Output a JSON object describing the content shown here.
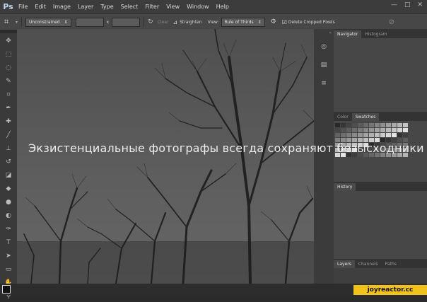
{
  "app": {
    "logo": "Ps"
  },
  "menubar": {
    "items": [
      "File",
      "Edit",
      "Image",
      "Layer",
      "Type",
      "Select",
      "Filter",
      "View",
      "Window",
      "Help"
    ]
  },
  "window_controls": {
    "minimize": "—",
    "maximize": "□",
    "close": "✕"
  },
  "options_bar": {
    "ratio_preset": "Unconstrained",
    "swap_symbol": "x",
    "clear_label": "Clear",
    "straighten_label": "Straighten",
    "view_label": "View:",
    "view_value": "Rule of Thirds",
    "delete_cropped_label": "Delete Cropped Pixels",
    "delete_cropped_checked": true
  },
  "panels": {
    "top_tabs": [
      "Navigator",
      "Histogram"
    ],
    "color_tabs": [
      "Color",
      "Swatches"
    ],
    "history_tab": "History",
    "bottom_tabs": [
      "Layers",
      "Channels",
      "Paths"
    ]
  },
  "canvas": {
    "caption": "Экзистенциальные фотографы всегда сохраняют безысходники"
  },
  "watermark": {
    "text": "joyreactor.cc"
  }
}
